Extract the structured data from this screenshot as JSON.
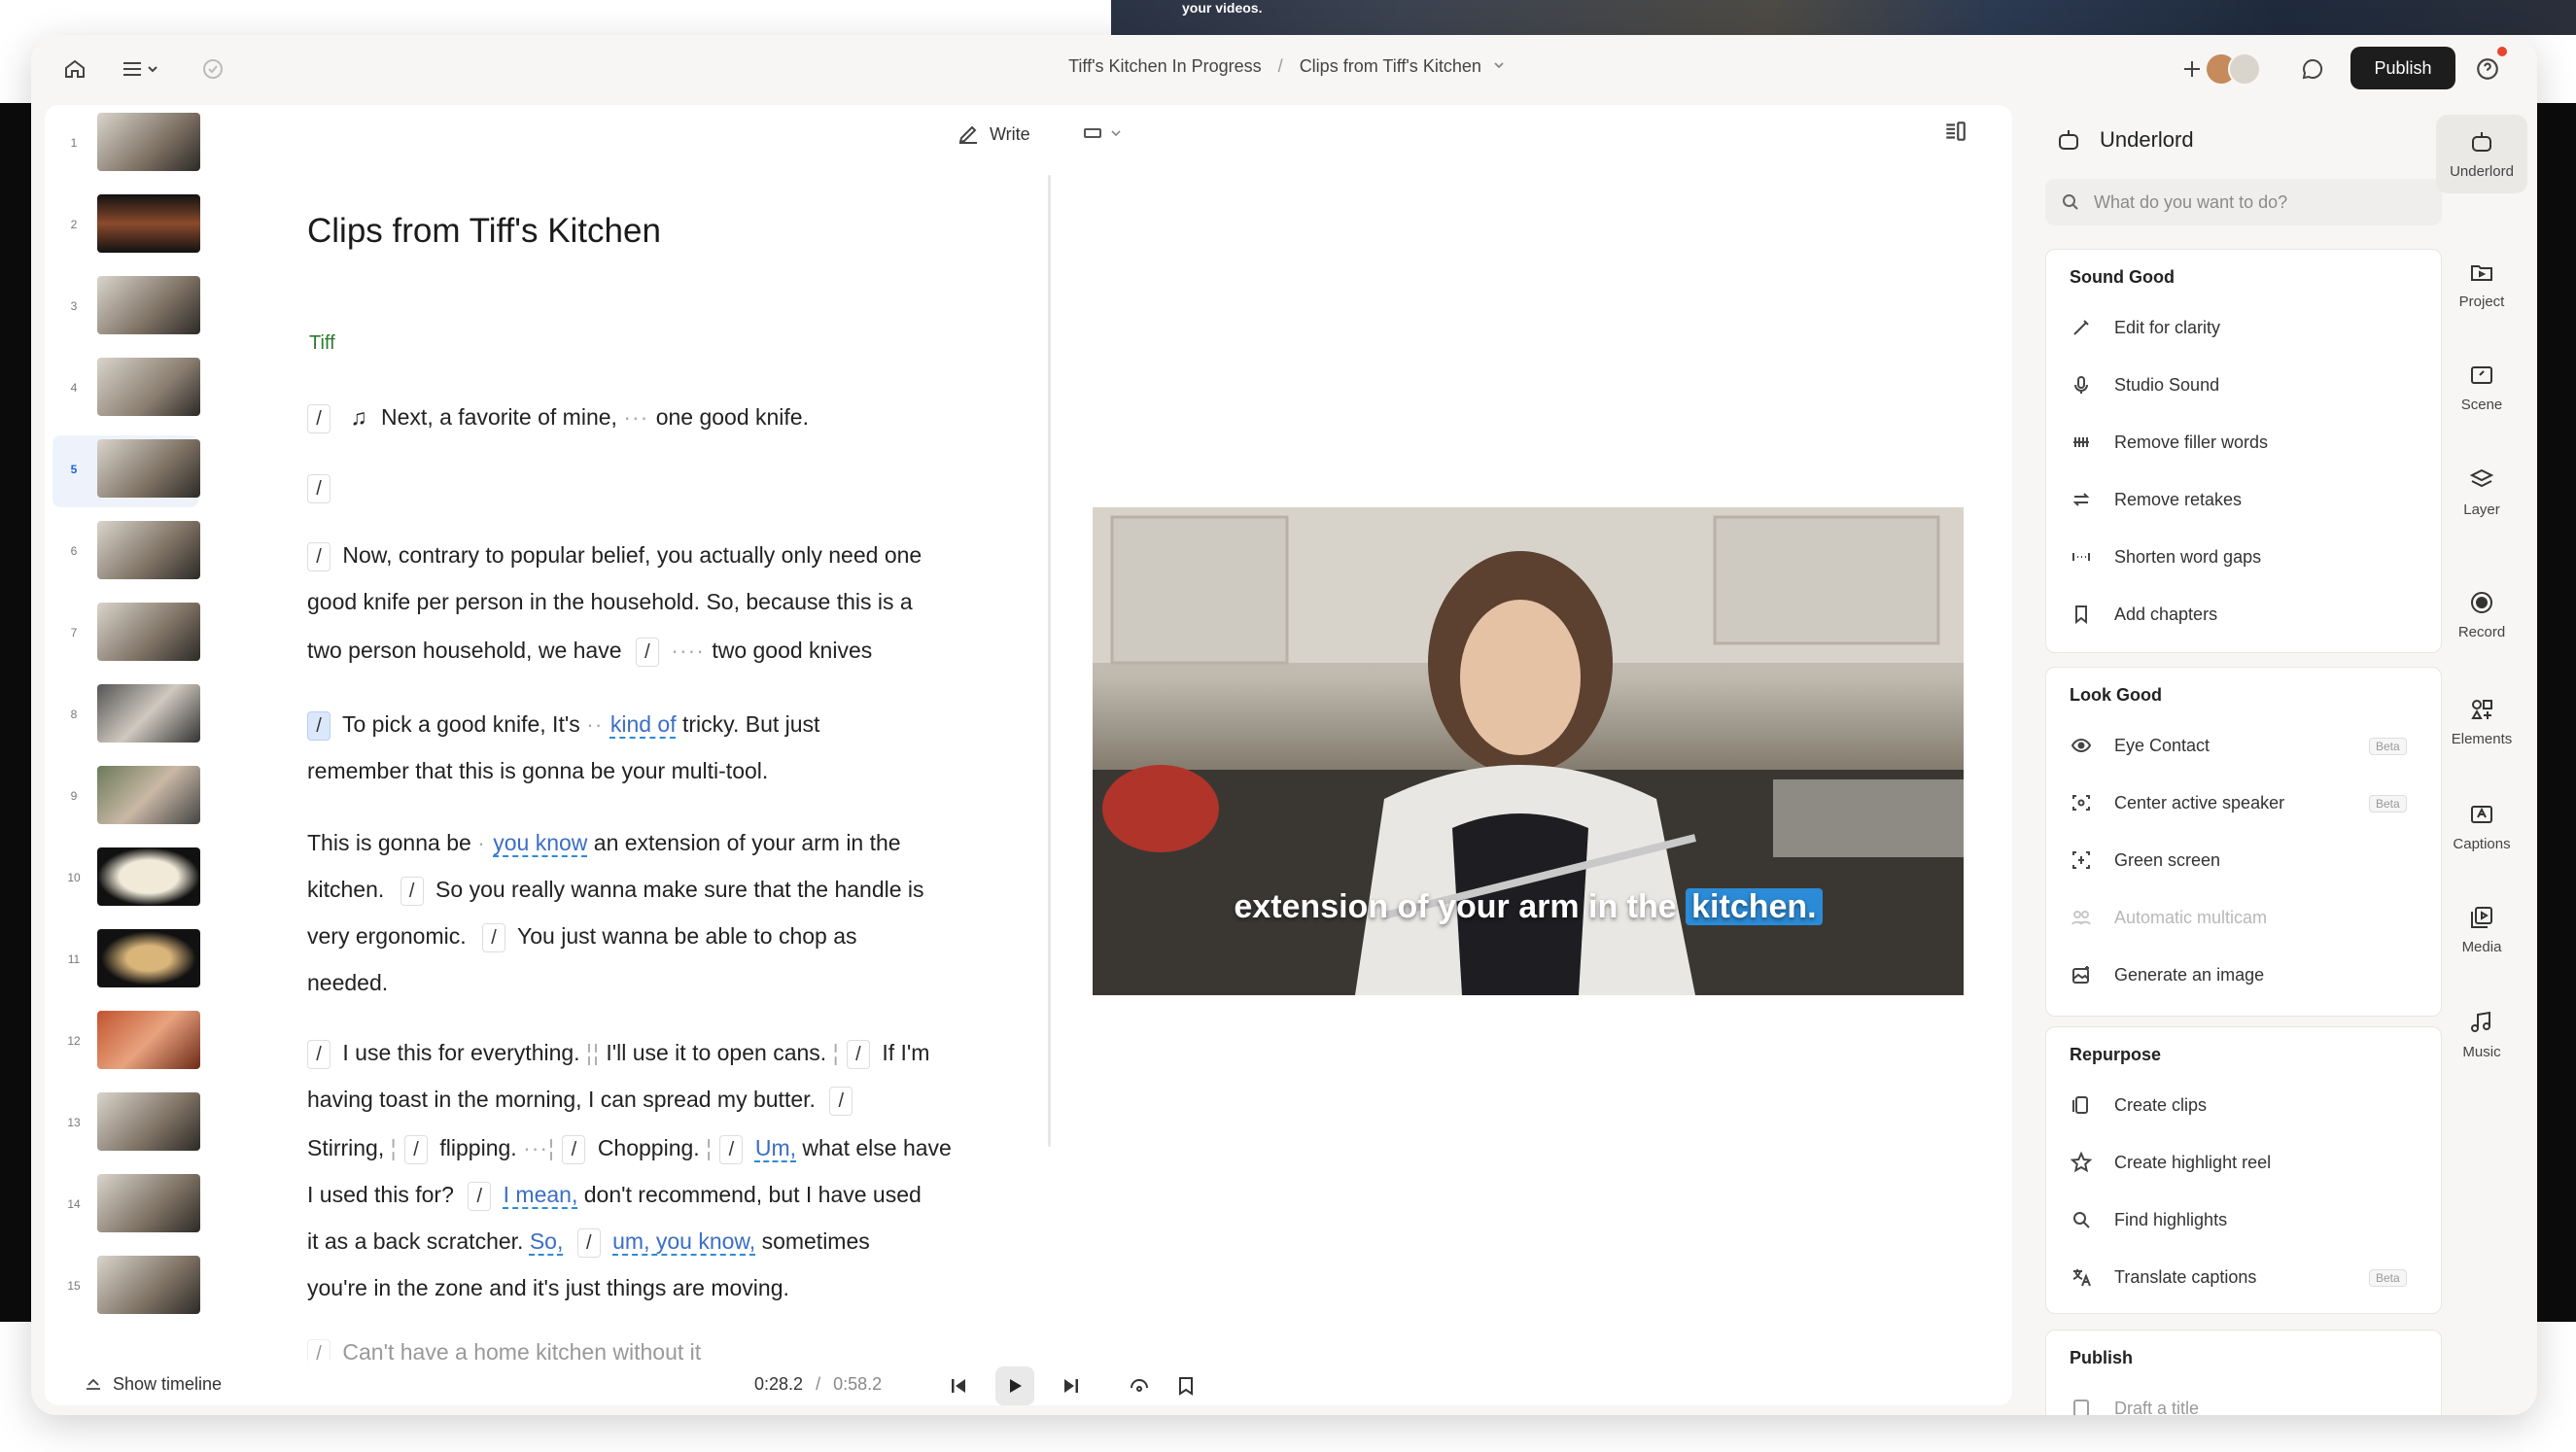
{
  "desktop": {
    "top_label": "your videos."
  },
  "topbar": {
    "breadcrumb_project": "Tiff's Kitchen In Progress",
    "breadcrumb_sep": "/",
    "breadcrumb_composition": "Clips from Tiff's Kitchen",
    "publish_label": "Publish"
  },
  "editor": {
    "write_label": "Write",
    "doc_title": "Clips from Tiff's Kitchen",
    "speaker": "Tiff",
    "thumbs": [
      "1",
      "2",
      "3",
      "4",
      "5",
      "6",
      "7",
      "8",
      "9",
      "10",
      "11",
      "12",
      "13",
      "14",
      "15"
    ],
    "active_scene": "5",
    "show_timeline_label": "Show timeline",
    "time_current": "0:28.2",
    "time_sep": "/",
    "time_total": "0:58.2",
    "caption_main": "extension of your arm in the",
    "caption_highlight": "kitchen."
  },
  "transcript": {
    "l1a": "Next, a favorite of mine,",
    "l1b": "one good knife.",
    "p3_1": "Now, contrary to popular belief, you actually only need one",
    "p3_2": "good knife per person in the household. So, because this is a",
    "p3_3a": "two person household, we have",
    "p3_3b": "two good knives",
    "p4_1a": "To pick a good knife, It's",
    "p4_1b": "kind of",
    "p4_1c": "tricky. But just",
    "p4_2": "remember that this is gonna be your multi-tool.",
    "p5_1a": "This is gonna be",
    "p5_1b": "you know",
    "p5_1c": "an extension of your arm in the",
    "p5_2a": "kitchen.",
    "p5_2b": "So you really wanna make sure that the handle is",
    "p5_3a": "very ergonomic.",
    "p5_3b": "You just wanna be able to chop as",
    "p5_4": "needed.",
    "p6_1a": "I use this for everything.",
    "p6_1b": "I'll use it to open cans.",
    "p6_1c": "If I'm",
    "p6_2": "having toast in the morning, I can spread my butter.",
    "p6_3a": "Stirring,",
    "p6_3b": "flipping.",
    "p6_3c": "Chopping.",
    "p6_3d": "Um,",
    "p6_3e": "what else have",
    "p6_4a": "I used this for?",
    "p6_4b": "I mean,",
    "p6_4c": "don't recommend, but I have used",
    "p6_5a": "it as a back scratcher.",
    "p6_5b": "So,",
    "p6_5c": "um, you know,",
    "p6_5d": "sometimes",
    "p6_6": "you're in the zone and it's just things are moving.",
    "p7_1": "Can't have a home kitchen without it"
  },
  "underlord": {
    "title": "Underlord",
    "search_placeholder": "What do you want to do?",
    "sound_good": {
      "title": "Sound Good",
      "items": [
        "Edit for clarity",
        "Studio Sound",
        "Remove filler words",
        "Remove retakes",
        "Shorten word gaps",
        "Add chapters"
      ]
    },
    "look_good": {
      "title": "Look Good",
      "items": [
        "Eye Contact",
        "Center active speaker",
        "Green screen",
        "Automatic multicam",
        "Generate an image"
      ],
      "beta": "Beta"
    },
    "repurpose": {
      "title": "Repurpose",
      "items": [
        "Create clips",
        "Create highlight reel",
        "Find highlights",
        "Translate captions"
      ],
      "beta": "Beta"
    },
    "publish": {
      "title": "Publish",
      "item": "Draft a title"
    }
  },
  "rail": [
    "Underlord",
    "Project",
    "Scene",
    "Layer",
    "Record",
    "Elements",
    "Captions",
    "Media",
    "Music"
  ],
  "colors": {
    "accent_blue": "#2b8bd6",
    "speaker_green": "#2e7a2e",
    "publish_bg": "#1d1d1d"
  }
}
